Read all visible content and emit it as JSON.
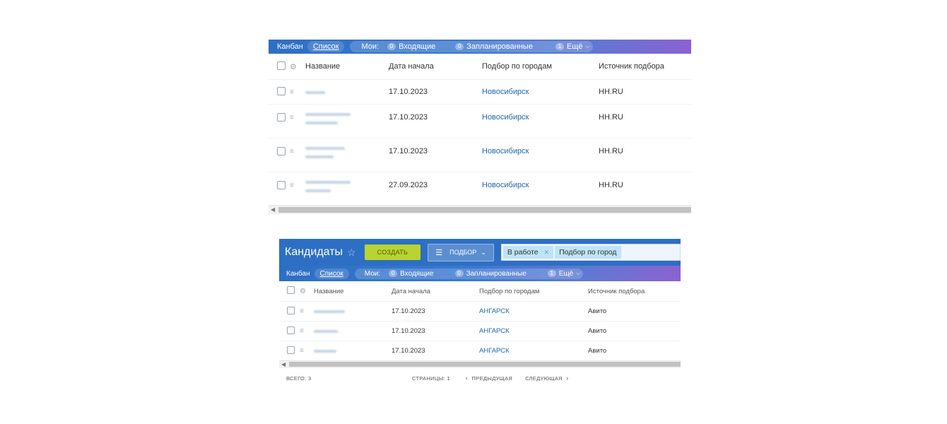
{
  "panel1": {
    "views": {
      "kanban": "Канбан",
      "list": "Список"
    },
    "mine": "Мои:",
    "incoming": {
      "count": "0",
      "label": "Входящие"
    },
    "planned": {
      "count": "0",
      "label": "Запланированные"
    },
    "more": {
      "count": "1",
      "label": "Ещё"
    },
    "columns": [
      "Название",
      "Дата начала",
      "Подбор по городам",
      "Источник подбора"
    ],
    "rows": [
      {
        "date": "17.10.2023",
        "city": "Новосибирск",
        "source": "HH.RU"
      },
      {
        "date": "17.10.2023",
        "city": "Новосибирск",
        "source": "HH.RU"
      },
      {
        "date": "17.10.2023",
        "city": "Новосибирск",
        "source": "HH.RU"
      },
      {
        "date": "27.09.2023",
        "city": "Новосибирск",
        "source": "HH.RU"
      }
    ]
  },
  "panel2": {
    "title": "Кандидаты",
    "create_label": "СОЗДАТЬ",
    "filter_label": "ПОДБОР",
    "filter_tags": [
      "В работе",
      "Подбор по город"
    ],
    "views": {
      "kanban": "Канбан",
      "list": "Список"
    },
    "mine": "Мои:",
    "incoming": {
      "count": "0",
      "label": "Входящие"
    },
    "planned": {
      "count": "0",
      "label": "Запланированные"
    },
    "more": {
      "count": "1",
      "label": "Ещё"
    },
    "columns": [
      "Название",
      "Дата начала",
      "Подбор по городам",
      "Источник подбора"
    ],
    "rows": [
      {
        "date": "17.10.2023",
        "city": "АНГАРСК",
        "source": "Авито"
      },
      {
        "date": "17.10.2023",
        "city": "АНГАРСК",
        "source": "Авито"
      },
      {
        "date": "17.10.2023",
        "city": "АНГАРСК",
        "source": "Авито"
      }
    ],
    "footer": {
      "total": "ВСЕГО: 3",
      "pages": "СТРАНИЦЫ: 1",
      "prev": "ПРЕДЫДУЩАЯ",
      "next": "СЛЕДУЮЩАЯ"
    }
  },
  "icons": {
    "gear": "gear-icon",
    "drag": "drag-handle-icon",
    "star": "star-icon",
    "chevron": "chevron-down-icon",
    "close": "close-icon",
    "filter": "filter-icon"
  },
  "colors": {
    "header_blue": "#2d6fc4",
    "create_green": "#b9d430",
    "link": "#2067b0",
    "tag_bg": "#bfe3f7"
  }
}
